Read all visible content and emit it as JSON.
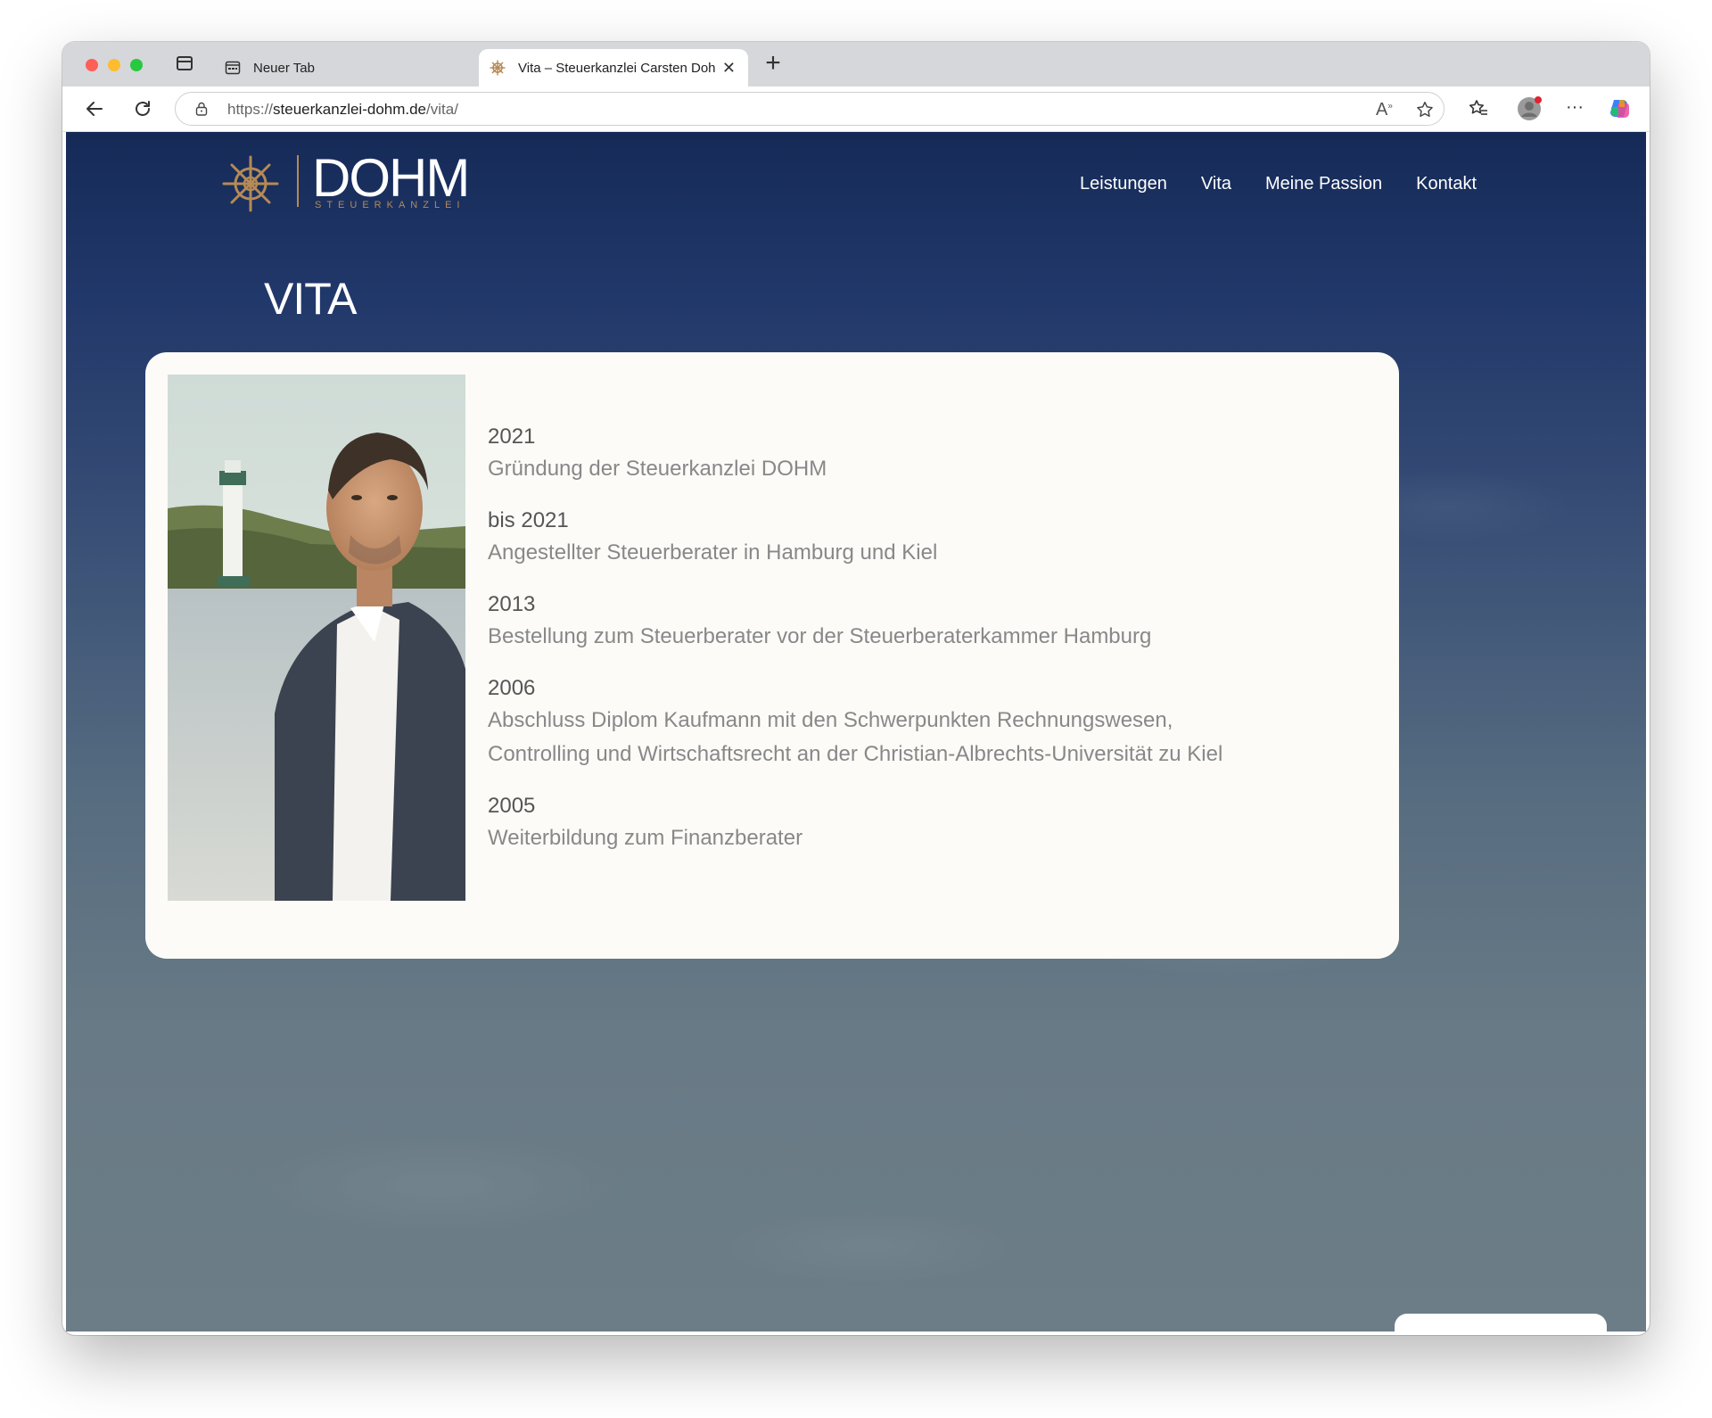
{
  "browser": {
    "tabs": [
      {
        "title": "Neuer Tab",
        "active": false
      },
      {
        "title": "Vita – Steuerkanzlei Carsten Dohm",
        "active": true
      }
    ],
    "url_prefix": "https://",
    "url_domain": "steuerkanzlei-dohm.de",
    "url_path": "/vita/",
    "icons": [
      "back-icon",
      "reload-icon",
      "lock-icon",
      "read-aloud-icon",
      "favorite-star-icon",
      "favorites-icon",
      "profile-icon",
      "more-icon",
      "copilot-icon"
    ]
  },
  "site": {
    "logo_word": "DOHM",
    "logo_sub": "STEUERKANZLEI",
    "nav": [
      "Leistungen",
      "Vita",
      "Meine Passion",
      "Kontakt"
    ],
    "page_title": "VITA",
    "accent_color": "#b58a56",
    "timeline": [
      {
        "year": "2021",
        "desc": "Gründung der Steuerkanzlei DOHM"
      },
      {
        "year": "bis 2021",
        "desc": "Angestellter Steuerberater in Hamburg und Kiel"
      },
      {
        "year": "2013",
        "desc": "Bestellung zum Steuerberater vor der Steuerberaterkammer Hamburg"
      },
      {
        "year": "2006",
        "desc_lines": [
          "Abschluss Diplom Kaufmann mit den Schwerpunkten Rechnungswesen,",
          "Controlling und Wirtschaftsrecht an der Christian-Albrechts-Universität zu Kiel"
        ]
      },
      {
        "year": "2005",
        "desc": "Weiterbildung zum Finanzberater"
      }
    ]
  }
}
